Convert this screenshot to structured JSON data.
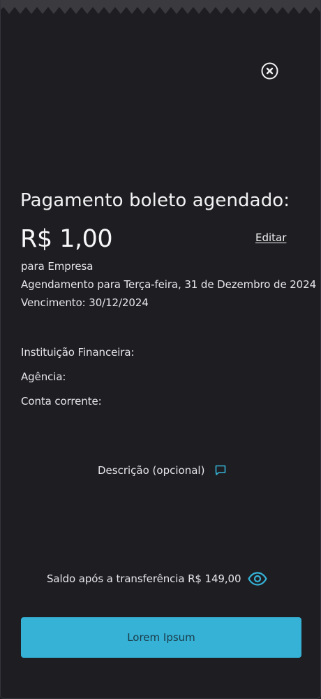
{
  "header": {
    "close_icon": "close-circle-icon"
  },
  "payment": {
    "title": "Pagamento boleto agendado:",
    "amount": "R$ 1,00",
    "edit_label": "Editar",
    "recipient": "para Empresa",
    "schedule": "Agendamento para Terça-feira, 31 de Dezembro de 2024",
    "due_date": "Vencimento: 30/12/2024"
  },
  "bank_details": {
    "institution_label": "Instituição Financeira:",
    "agency_label": "Agência:",
    "account_label": "Conta corrente:"
  },
  "description": {
    "label": "Descrição (opcional)",
    "icon": "comment-icon"
  },
  "balance": {
    "text": "Saldo após a transferência R$ 149,00",
    "icon": "eye-icon"
  },
  "actions": {
    "primary_label": "Lorem Ipsum"
  },
  "colors": {
    "background": "#1e1e22",
    "accent": "#35b2d6",
    "text": "#f2f2f4",
    "button_text": "#1b3a48"
  }
}
